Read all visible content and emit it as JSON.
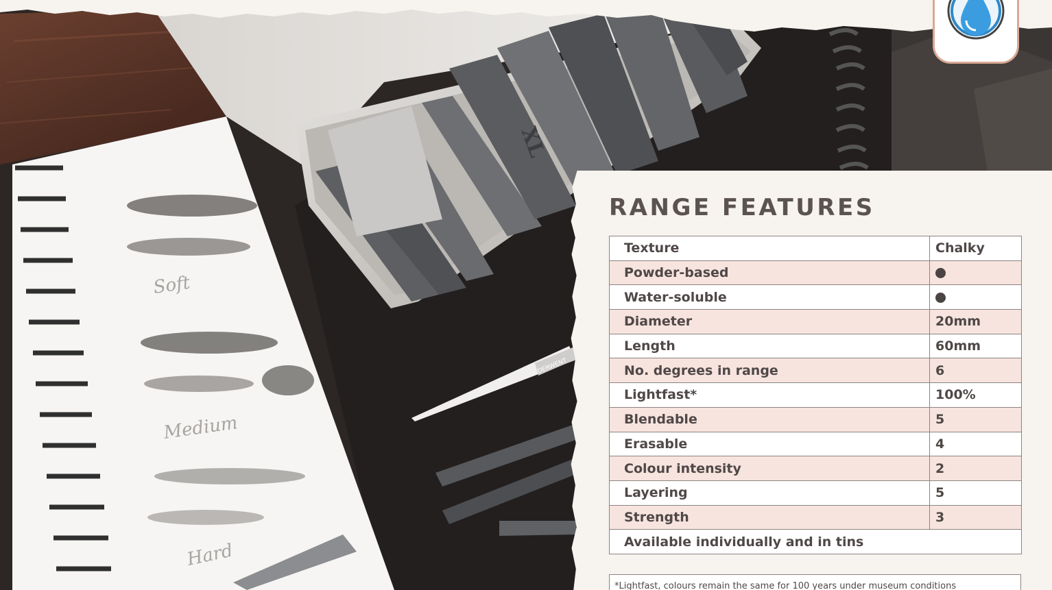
{
  "header": {
    "title": "RANGE FEATURES"
  },
  "badge": {
    "icon": "water-drop-icon",
    "accent": "#d9a894"
  },
  "features": [
    {
      "label": "Texture",
      "value": "Chalky"
    },
    {
      "label": "Powder-based",
      "value": "dot"
    },
    {
      "label": "Water-soluble",
      "value": "dot"
    },
    {
      "label": "Diameter",
      "value": "20mm"
    },
    {
      "label": "Length",
      "value": "60mm"
    },
    {
      "label": "No. degrees in range",
      "value": "6"
    },
    {
      "label": "Lightfast*",
      "value": "100%"
    },
    {
      "label": "Blendable",
      "value": "5"
    },
    {
      "label": "Erasable",
      "value": "4"
    },
    {
      "label": "Colour intensity",
      "value": "2"
    },
    {
      "label": "Layering",
      "value": "5"
    },
    {
      "label": "Strength",
      "value": "3"
    }
  ],
  "availability": "Available individually and in tins",
  "footnote": "*Lightfast, colours remain the same for 100 years under museum conditions",
  "photo": {
    "sketch_labels": [
      "Soft",
      "Medium",
      "Hard"
    ],
    "product_mark": "XL",
    "brand_mark": "DERWENT"
  },
  "colors": {
    "heading": "#5b5352",
    "row_tint": "#f7e4de",
    "paper": "#f7f3ef"
  }
}
